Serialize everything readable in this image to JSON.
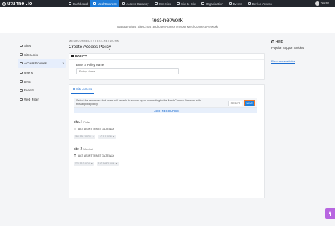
{
  "brand": {
    "name": "utunnel.io"
  },
  "nav": [
    {
      "label": "Dashboard",
      "icon": "dashboard-icon"
    },
    {
      "label": "MeshConnect",
      "icon": "mesh-icon",
      "active": true
    },
    {
      "label": "Access Gateway",
      "icon": "gateway-icon"
    },
    {
      "label": "OneClick",
      "icon": "oneclick-icon"
    },
    {
      "label": "Site-to-Site",
      "icon": "site-to-site-icon"
    },
    {
      "label": "Organization",
      "icon": "organization-icon"
    },
    {
      "label": "Events",
      "icon": "events-icon"
    },
    {
      "label": "Device Access",
      "icon": "device-access-icon"
    }
  ],
  "user": {
    "name": "Test B..."
  },
  "network": {
    "title": "test-network",
    "subtitle": "Manage Sites, Site Links, and User Access on your MeshConnect Network"
  },
  "sidebar": [
    {
      "label": "Sites",
      "icon": "sites-icon"
    },
    {
      "label": "Site Links",
      "icon": "link-icon"
    },
    {
      "label": "Access Policies",
      "icon": "policy-icon",
      "active": true,
      "chevron": "›"
    },
    {
      "label": "Users",
      "icon": "users-icon"
    },
    {
      "label": "DNS",
      "icon": "dns-icon"
    },
    {
      "label": "Events",
      "icon": "events-icon"
    },
    {
      "label": "Web Filter",
      "icon": "web-filter-icon"
    }
  ],
  "breadcrumb": {
    "root": "MESHCONNECT",
    "sep": "/",
    "current": "TEST-NETWORK"
  },
  "page": {
    "title": "Create Access Policy"
  },
  "policy": {
    "section_label": "POLICY",
    "name_label": "Enter a Policy Name",
    "name_placeholder": "Policy Name",
    "name_value": ""
  },
  "access": {
    "tab_label": "Site Access",
    "info_text": "Select the resources that users will be able to access upon connecting to the MeshConnect Network with this applied policy.",
    "reset_label": "RESET",
    "save_label": "SAVE",
    "add_resource_label": "+ ADD RESOURCE",
    "sites": [
      {
        "name": "site-1",
        "location": "Dallas",
        "radio_label": "ACT AS INTERNET GATEWAY",
        "chips": [
          "192.168.1.0/24",
          "10.1.0.0/16"
        ]
      },
      {
        "name": "site-2",
        "location": "Mumbai",
        "radio_label": "ACT AS INTERNET GATEWAY",
        "chips": [
          "172.16.0.0/24",
          "192.168.2.0/24"
        ]
      }
    ]
  },
  "help": {
    "title": "Help",
    "subtitle": "Popular Support Articles",
    "link": "Read more articles"
  },
  "colors": {
    "accent": "#1d7bd8",
    "save_outline": "#f07a2b",
    "fab": "#b766e0",
    "topbar": "#23272d"
  }
}
